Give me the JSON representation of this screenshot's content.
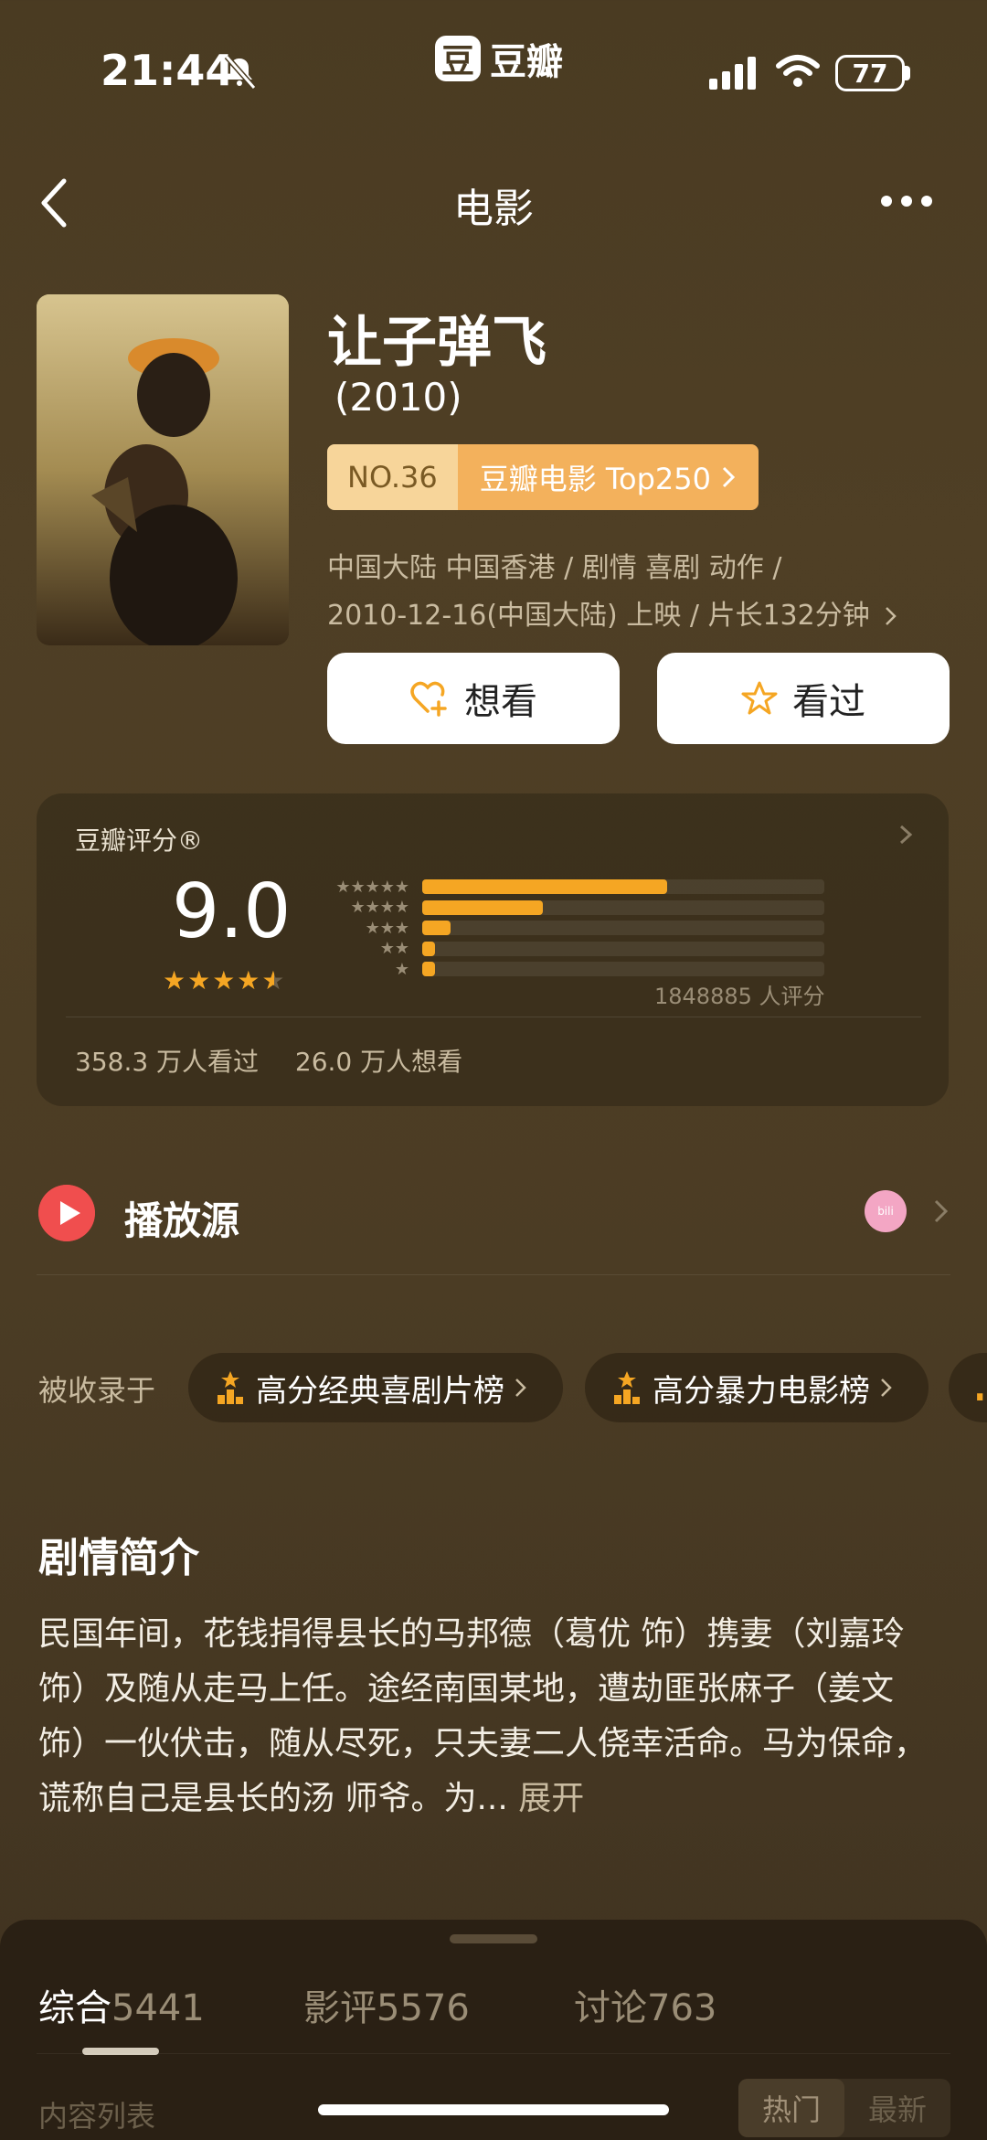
{
  "status_bar": {
    "time": "21:44",
    "battery": "77"
  },
  "app": {
    "logo_char": "豆",
    "name": "豆瓣"
  },
  "nav": {
    "title": "电影"
  },
  "movie": {
    "title": "让子弹飞",
    "year": "(2010)",
    "rank_no": "NO.36",
    "rank_list": "豆瓣电影 Top250",
    "meta_line1": "中国大陆 中国香港 / 剧情 喜剧 动作 /",
    "meta_line2": "2010-12-16(中国大陆) 上映 / 片长132分钟",
    "want_label": "想看",
    "seen_label": "看过"
  },
  "rating": {
    "label": "豆瓣评分®",
    "score": "9.0",
    "stars_rating": 4.5,
    "distribution": [
      {
        "stars": "★★★★★",
        "value": 0.61
      },
      {
        "stars": "★★★★",
        "value": 0.3
      },
      {
        "stars": "★★★",
        "value": 0.07
      },
      {
        "stars": "★★",
        "value": 0.03
      },
      {
        "stars": "★",
        "value": 0.03
      }
    ],
    "count": "1848885 人评分",
    "watched": "358.3 万人看过",
    "wanted": "26.0 万人想看"
  },
  "play_source": {
    "label": "播放源",
    "provider_icon": "bilibili-icon"
  },
  "collections": {
    "label": "被收录于",
    "items": [
      "高分经典喜剧片榜",
      "高分暴力电影榜"
    ]
  },
  "synopsis": {
    "title": "剧情简介",
    "text": "民国年间，花钱捐得县长的马邦德（葛优 饰）携妻（刘嘉玲 饰）及随从走马上任。途经南国某地，遭劫匪张麻子（姜文 饰）一伙伏击，随从尽死，只夫妻二人侥幸活命。马为保命，谎称自己是县长的汤 师爷。为...",
    "expand": "展开"
  },
  "bottom_sheet": {
    "tabs": [
      {
        "label": "综合",
        "count": "5441"
      },
      {
        "label": "影评",
        "count": "5576"
      },
      {
        "label": "讨论",
        "count": "763"
      }
    ],
    "list_label": "内容列表",
    "sort_hot": "热门",
    "sort_new": "最新"
  },
  "colors": {
    "accent": "#f5a623",
    "background": "#4a3b22",
    "play": "#f04e4e"
  }
}
